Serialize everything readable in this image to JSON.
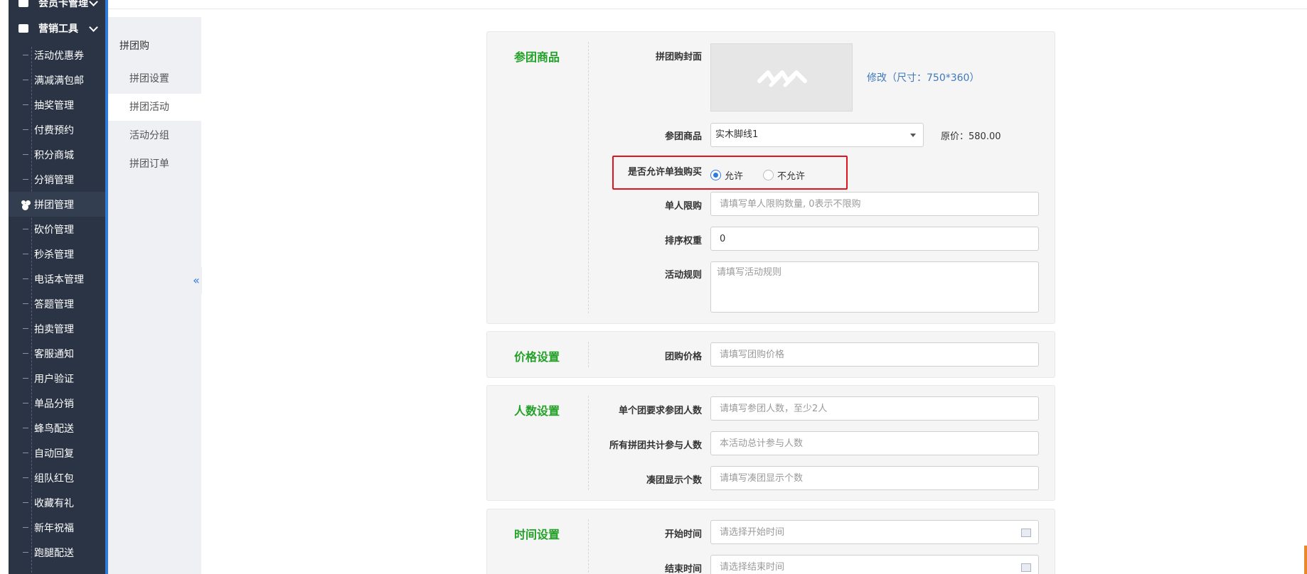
{
  "sidebar": {
    "top_group": "会员卡管理",
    "group": "营销工具",
    "items": [
      {
        "label": "活动优惠券"
      },
      {
        "label": "满减满包邮"
      },
      {
        "label": "抽奖管理"
      },
      {
        "label": "付费预约"
      },
      {
        "label": "积分商城"
      },
      {
        "label": "分销管理"
      },
      {
        "label": "拼团管理",
        "active": true
      },
      {
        "label": "砍价管理"
      },
      {
        "label": "秒杀管理"
      },
      {
        "label": "电话本管理"
      },
      {
        "label": "答题管理"
      },
      {
        "label": "拍卖管理"
      },
      {
        "label": "客服通知"
      },
      {
        "label": "用户验证"
      },
      {
        "label": "单品分销"
      },
      {
        "label": "蜂鸟配送"
      },
      {
        "label": "自动回复"
      },
      {
        "label": "组队红包"
      },
      {
        "label": "收藏有礼"
      },
      {
        "label": "新年祝福"
      },
      {
        "label": "跑腿配送"
      }
    ]
  },
  "subnav": {
    "title": "拼团购",
    "items": [
      {
        "label": "拼团设置"
      },
      {
        "label": "拼团活动",
        "active": true
      },
      {
        "label": "活动分组"
      },
      {
        "label": "拼团订单"
      }
    ],
    "collapse_glyph": "«"
  },
  "sections": {
    "goods": {
      "title": "参团商品",
      "cover_label": "拼团购封面",
      "cover_link": "修改（尺寸：750*360）",
      "goods_label": "参团商品",
      "goods_value": "实木脚线1",
      "orig_price": "原价：580.00",
      "single_buy_label": "是否允许单独购买",
      "allow": "允许",
      "disallow": "不允许",
      "limit_label": "单人限购",
      "limit_placeholder": "请填写单人限购数量, 0表示不限购",
      "sort_label": "排序权重",
      "sort_value": "0",
      "rules_label": "活动规则",
      "rules_placeholder": "请填写活动规则"
    },
    "price": {
      "title": "价格设置",
      "group_price_label": "团购价格",
      "group_price_placeholder": "请填写团购价格"
    },
    "people": {
      "title": "人数设置",
      "per_group_label": "单个团要求参团人数",
      "per_group_placeholder": "请填写参团人数，至少2人",
      "total_label": "所有拼团共计参与人数",
      "total_placeholder": "本活动总计参与人数",
      "display_label": "凑团显示个数",
      "display_placeholder": "请填写凑团显示个数"
    },
    "time": {
      "title": "时间设置",
      "start_label": "开始时间",
      "start_placeholder": "请选择开始时间",
      "end_label": "结束时间",
      "end_placeholder": "请选择结束时间"
    }
  },
  "colors": {
    "sidebar_bg": "#2b3445",
    "section_title": "#22a028",
    "link": "#3f79bd",
    "highlight_border": "#e0141e",
    "radio_accent": "#2f7bd9"
  }
}
